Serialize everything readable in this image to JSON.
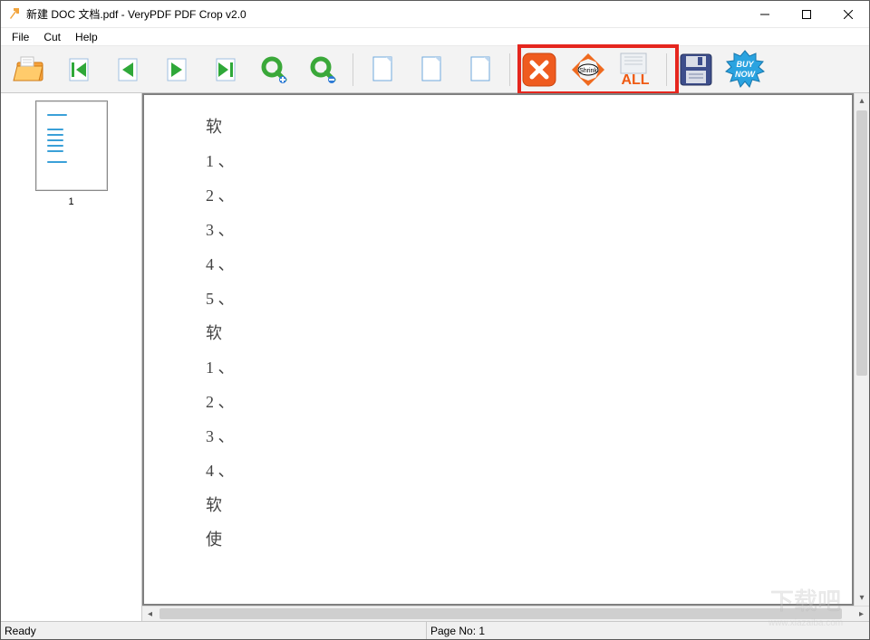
{
  "window": {
    "title": "新建 DOC 文档.pdf - VeryPDF PDF Crop v2.0"
  },
  "menu": {
    "file": "File",
    "cut": "Cut",
    "help": "Help"
  },
  "toolbar": {
    "open": "open",
    "first": "first-page",
    "prev": "prev-page",
    "next": "next-page",
    "last": "last-page",
    "zoom_in": "zoom-in",
    "zoom_out": "zoom-out",
    "page_a": "new-page",
    "page_b": "copy-page",
    "page_c": "blank-page",
    "delete": "delete",
    "shrink": "Shrink",
    "all": "ALL",
    "save": "save",
    "buy": "BUY NOW"
  },
  "thumbs": {
    "page1_label": "1"
  },
  "document": {
    "lines": [
      "软",
      "1 、",
      "2 、",
      "3 、",
      "4 、",
      "5 、",
      "软",
      "1 、",
      "2 、",
      "3 、",
      "4 、",
      "软",
      "使"
    ]
  },
  "status": {
    "ready": "Ready",
    "page": "Page No: 1"
  },
  "watermark": {
    "main": "下载吧",
    "sub": "www.xiazaiba.com"
  }
}
